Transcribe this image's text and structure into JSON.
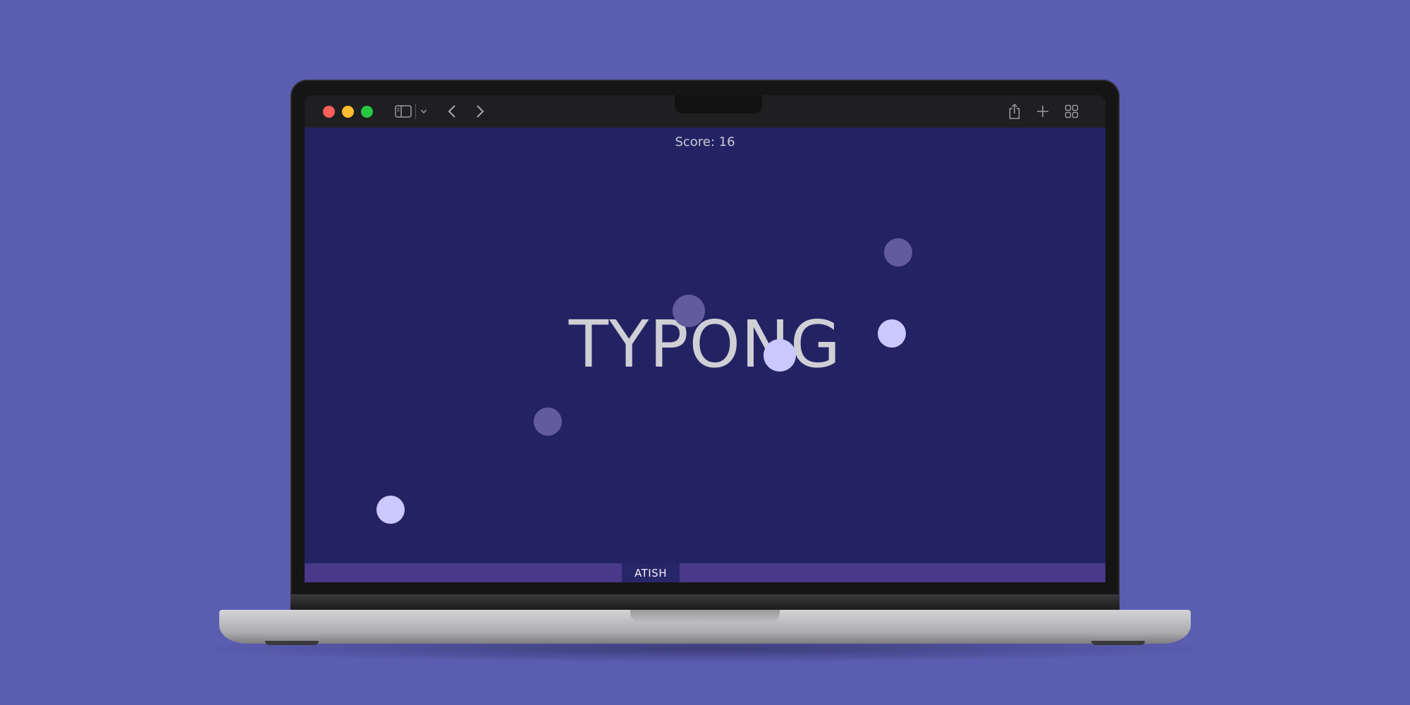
{
  "game": {
    "score_text": "Score: 16",
    "title": "TYPONG",
    "paddle_word": "ATISH"
  },
  "toolbar": {
    "icons": [
      "sidebar-icon",
      "chevron-down-icon",
      "back-icon",
      "forward-icon",
      "share-icon",
      "new-tab-icon",
      "tab-overview-icon"
    ]
  },
  "colors": {
    "desktop_background": "#5b5db1",
    "game_background": "#232364",
    "bottom_bar": "#4a3888",
    "paddle": "#28266a",
    "ball_bright": "#cbc8ff",
    "ball_dim": "#635c9c"
  }
}
